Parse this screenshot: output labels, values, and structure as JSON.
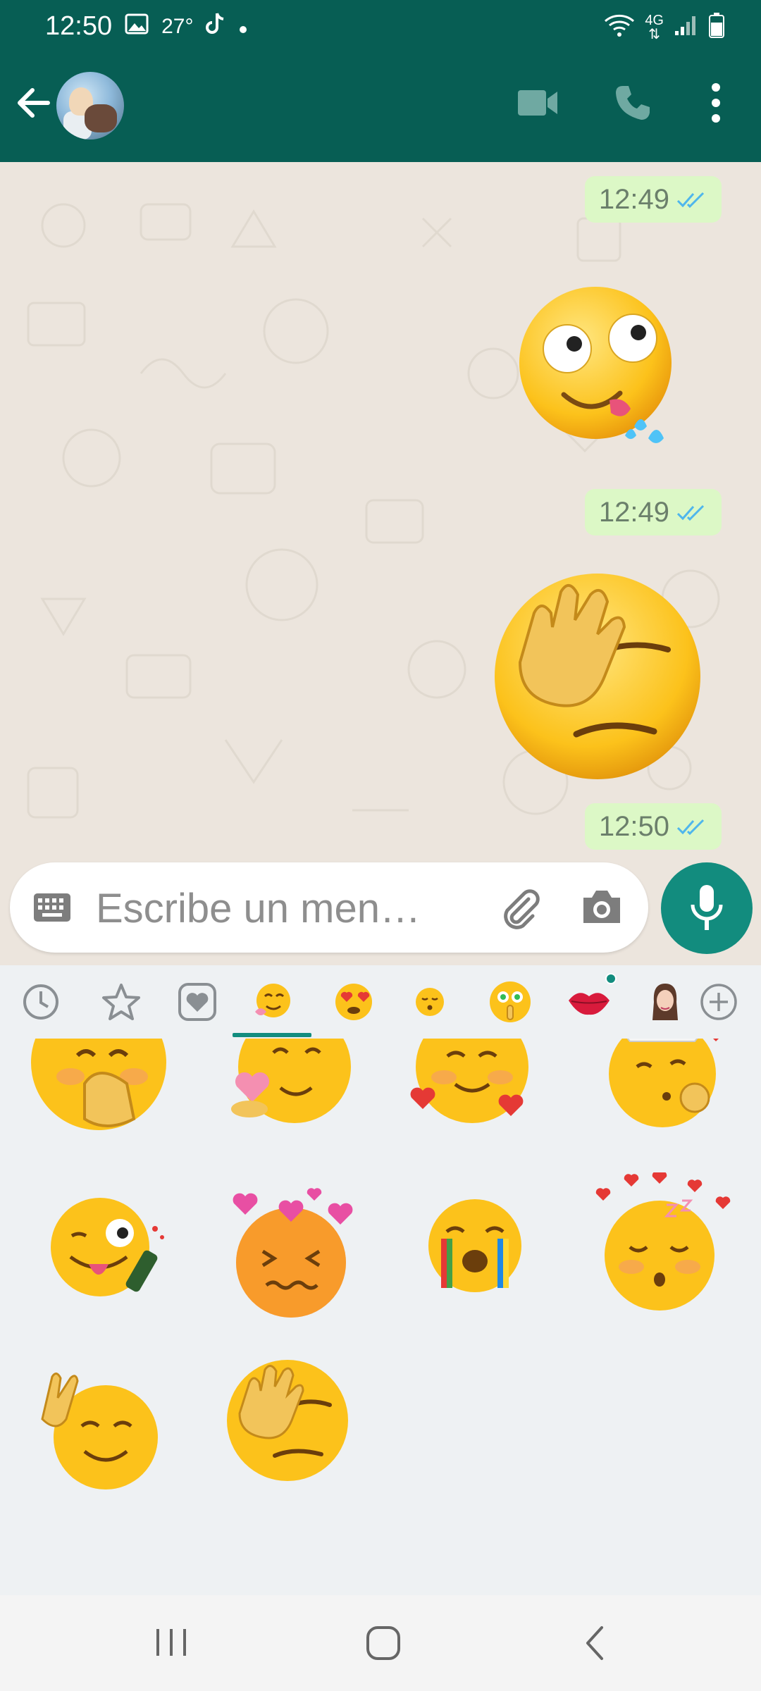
{
  "status_bar": {
    "time": "12:50",
    "temperature": "27°",
    "network": "4G",
    "icons": [
      "image-icon",
      "tiktok-icon",
      "dot-icon",
      "wifi-icon",
      "signal-icon",
      "battery-icon"
    ]
  },
  "app_bar": {
    "icons": [
      "back-arrow-icon",
      "video-call-icon",
      "phone-icon",
      "more-vert-icon"
    ]
  },
  "messages": [
    {
      "type": "sticker",
      "sticker": "drooling-googly-eyes",
      "time": "12:49",
      "status": "read"
    },
    {
      "type": "sticker",
      "sticker": "facepalm",
      "time": "12:49",
      "status": "read"
    }
  ],
  "first_time": "12:49",
  "last_time": "12:50",
  "composer": {
    "placeholder": "Escribe un men…",
    "icons": [
      "keyboard-icon",
      "attach-icon",
      "camera-icon",
      "mic-icon"
    ]
  },
  "sticker_tabs": [
    "recent-icon",
    "star-icon",
    "heart-icon",
    "hug-pack",
    "love-pack",
    "kiss-pack",
    "shh-pack",
    "lips-pack",
    "avatar-pack",
    "add-icon"
  ],
  "active_tab": "hug-pack",
  "sticker_grid": [
    "hand-over-mouth",
    "smiling-heart",
    "hearts-face",
    "chef-kiss",
    "zany-bottle",
    "overwhelmed-hearts",
    "rainbow-cry",
    "sleepy-hearts",
    "fingers-crossed",
    "facepalm"
  ],
  "colors": {
    "header": "#075e54",
    "accent": "#128c7e",
    "bubble": "#dcf8c6",
    "read_ticks": "#4fb6ec"
  }
}
